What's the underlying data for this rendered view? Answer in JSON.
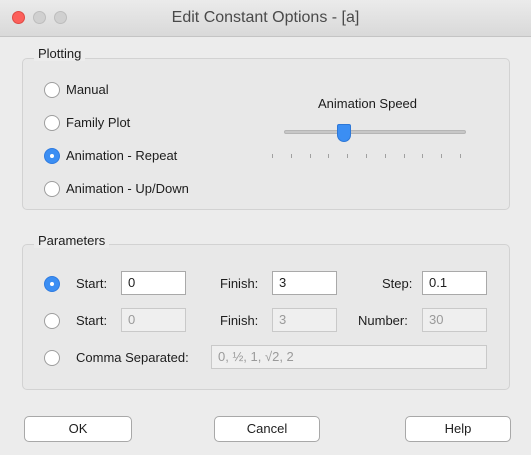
{
  "window": {
    "title": "Edit Constant Options - [a]"
  },
  "plotting": {
    "legend": "Plotting",
    "options": [
      {
        "label": "Manual",
        "selected": false
      },
      {
        "label": "Family Plot",
        "selected": false
      },
      {
        "label": "Animation - Repeat",
        "selected": true
      },
      {
        "label": "Animation - Up/Down",
        "selected": false
      }
    ],
    "speed_label": "Animation Speed",
    "speed_value": 0.33,
    "tick_count": 11
  },
  "parameters": {
    "legend": "Parameters",
    "row1": {
      "selected": true,
      "start_label": "Start:",
      "start_value": "0",
      "finish_label": "Finish:",
      "finish_value": "3",
      "step_label": "Step:",
      "step_value": "0.1"
    },
    "row2": {
      "selected": false,
      "start_label": "Start:",
      "start_value": "0",
      "finish_label": "Finish:",
      "finish_value": "3",
      "number_label": "Number:",
      "number_value": "30"
    },
    "row3": {
      "selected": false,
      "comma_label": "Comma Separated:",
      "comma_value": "0, ½, 1, √2, 2"
    }
  },
  "buttons": {
    "ok": "OK",
    "cancel": "Cancel",
    "help": "Help"
  },
  "colors": {
    "accent": "#3b8ef3",
    "close": "#fc605b"
  }
}
